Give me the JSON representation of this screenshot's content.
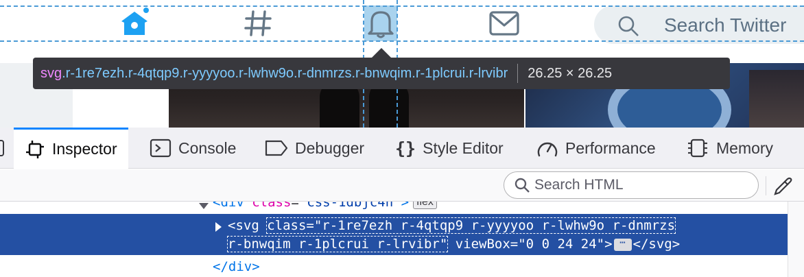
{
  "page": {
    "search_placeholder": "Search Twitter",
    "nav_icons": [
      "home-icon",
      "explore-hashtag-icon",
      "notifications-bell-icon",
      "messages-envelope-icon"
    ]
  },
  "tooltip": {
    "tag": "svg",
    "classes": ".r-1re7ezh.r-4qtqp9.r-yyyyoo.r-lwhw9o.r-dnmrzs.r-bnwqim.r-1plcrui.r-lrvibr",
    "dimensions": "26.25 × 26.25"
  },
  "devtools": {
    "tabs": [
      {
        "label": "Inspector",
        "icon": "inspector-icon",
        "selected": true
      },
      {
        "label": "Console",
        "icon": "console-icon"
      },
      {
        "label": "Debugger",
        "icon": "debugger-icon"
      },
      {
        "label": "Style Editor",
        "icon": "style-editor-icon"
      },
      {
        "label": "Performance",
        "icon": "performance-icon"
      },
      {
        "label": "Memory",
        "icon": "memory-icon"
      }
    ],
    "search_placeholder": "Search HTML",
    "colors": {
      "accent": "#0a84ff",
      "selection": "#2450a3"
    }
  },
  "markup": {
    "div_row": {
      "open": "<div ",
      "attr": "class",
      "eq": "=",
      "value": "\"css-1dbjc4n\"",
      "close": ">",
      "badge": "flex"
    },
    "svg_row": {
      "open": "<svg ",
      "class_attr_line1": "class=\"r-1re7ezh r-4qtqp9 r-yyyyoo r-lwhw9o r-dnmrzs",
      "class_attr_line2": "r-bnwqim r-1plcrui r-lrvibr\"",
      "rest": " viewBox=\"0 0 24 24\">",
      "ellipsis": "⋯",
      "end": "</svg>"
    },
    "close_row": "</div>"
  }
}
